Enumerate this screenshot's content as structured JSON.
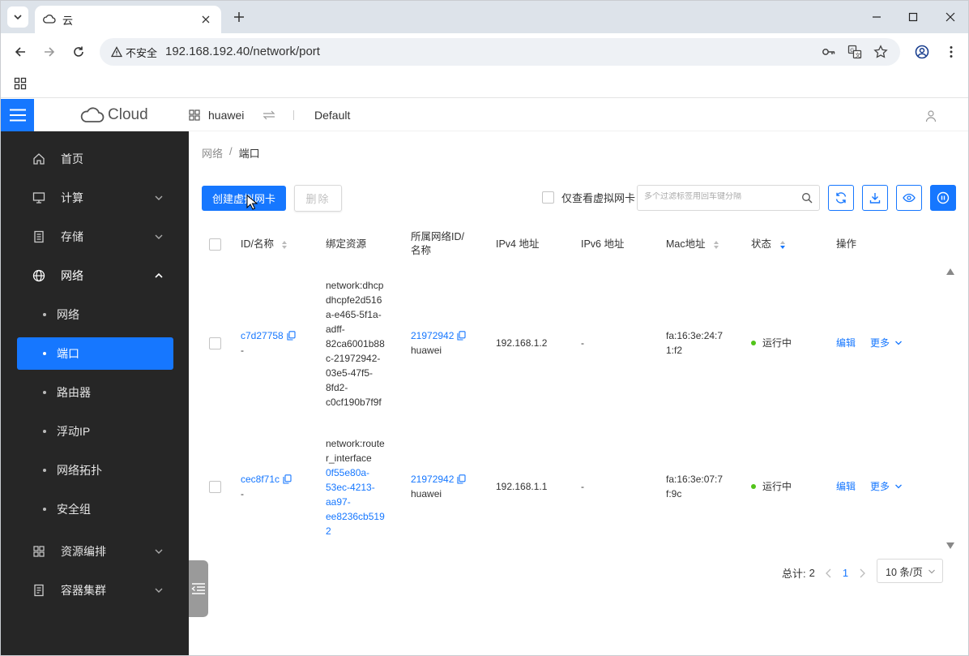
{
  "browser": {
    "tab_title": "云",
    "security_label": "不安全",
    "url": "192.168.192.40/network/port"
  },
  "header": {
    "logo_text": "Cloud",
    "project": "huawei",
    "region": "Default"
  },
  "sidebar": {
    "items": [
      {
        "label": "首页",
        "icon": "home-icon"
      },
      {
        "label": "计算",
        "icon": "monitor-icon"
      },
      {
        "label": "存储",
        "icon": "storage-icon"
      },
      {
        "label": "网络",
        "icon": "globe-icon"
      },
      {
        "label": "资源编排",
        "icon": "grid-icon"
      },
      {
        "label": "容器集群",
        "icon": "container-icon"
      }
    ],
    "network_sub": [
      "网络",
      "端口",
      "路由器",
      "浮动IP",
      "网络拓扑",
      "安全组"
    ],
    "active_sub": "端口"
  },
  "breadcrumb": {
    "parent": "网络",
    "separator": "/",
    "current": "端口"
  },
  "toolbar": {
    "create_label": "创建虚拟网卡",
    "delete_label": "删除",
    "virtual_only_label": "仅查看虚拟网卡",
    "search_placeholder": "多个过滤标签用回车键分隔"
  },
  "table": {
    "columns": [
      "ID/名称",
      "绑定资源",
      "所属网络ID/\n名称",
      "IPv4 地址",
      "IPv6 地址",
      "Mac地址",
      "状态",
      "操作"
    ],
    "rows": [
      {
        "id": "c7d27758",
        "name": "-",
        "resource_type": "network:dhcp",
        "resource_id": "dhcpfe2d516\na-e465-5f1a-\nadff-\n82ca6001b88\nc-21972942-\n03e5-47f5-\n8fd2-\nc0cf190b7f9f",
        "network_id": "21972942",
        "network_name": "huawei",
        "ipv4": "192.168.1.2",
        "ipv6": "-",
        "mac": "fa:16:3e:24:7\n1:f2",
        "status": "运行中",
        "edit": "编辑",
        "more": "更多"
      },
      {
        "id": "cec8f71c",
        "name": "-",
        "resource_type": "network:route\nr_interface",
        "resource_id": "0f55e80a-\n53ec-4213-\naa97-\nee8236cb519\n2",
        "network_id": "21972942",
        "network_name": "huawei",
        "ipv4": "192.168.1.1",
        "ipv6": "-",
        "mac": "fa:16:3e:07:7\nf:9c",
        "status": "运行中",
        "edit": "编辑",
        "more": "更多"
      }
    ]
  },
  "pagination": {
    "total_label": "总计:",
    "total": "2",
    "current_page": "1",
    "page_size": "10 条/页"
  },
  "colors": {
    "primary": "#1677ff",
    "sidebar_bg": "#262626",
    "status_running": "#52c41a"
  }
}
